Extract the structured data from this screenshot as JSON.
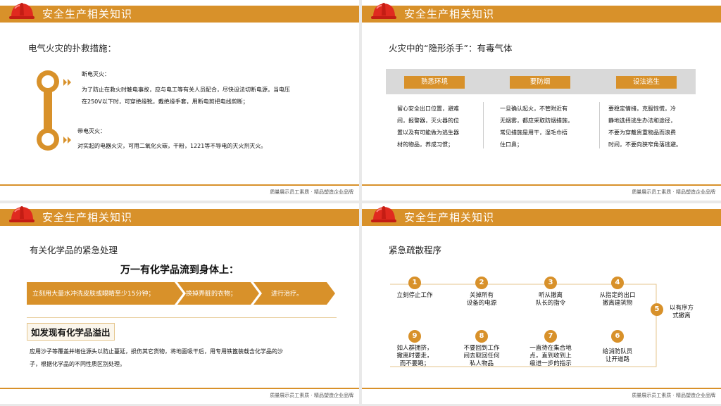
{
  "header_title": "安全生产相关知识",
  "footer": "质量展示员工素质 · 精品塑造企业品牌",
  "slide1": {
    "subtitle": "电气火灾的扑救措施：",
    "item1_title": "断电灭火：",
    "item1_text1": "为了防止在救火时触电事故，应与电工等有关人员配合，尽快设法切断电源，当电压",
    "item1_text2": "在250V以下时，可穿绝缘靴，戴绝缘手套，用断电剪把电线剪断；",
    "item2_title": "带电灭火：",
    "item2_text": "对实起的电器火灾，可用二氧化火碳，干粉，1221等不导电的灭火剂灭火。"
  },
  "slide2": {
    "subtitle": "火灾中的“隐形杀手”：有毒气体",
    "tabs": [
      "熟悉环境",
      "要防烟",
      "设法逃生"
    ],
    "col1": [
      "留心安全出口位置，避难",
      "间，报警器，灭火器的位",
      "置以及有可能做为逃生器",
      "材的物品，养成习惯；"
    ],
    "col2": [
      "一旦确认起火，不管附近有",
      "无烟雾，都应采取防烟措施，",
      "常见措施是用干，湿毛巾捂",
      "住口鼻；"
    ],
    "col3": [
      "要稳定情绪，克服惊慌，冷",
      "静地选择逃生办法和途径，",
      "不要为穿戴贵重物品而浪费",
      "时间，不要向狭窄角落逃避。"
    ]
  },
  "slide3": {
    "subtitle": "有关化学品的紧急处理",
    "heading": "万一有化学品流到身体上：",
    "arrows": [
      "立刻用大量水冲洗皮肤或眼睛至少15分钟；",
      "换掉弄脏的衣物；",
      "进行治疗。"
    ],
    "box_title": "如发现有化学品溢出",
    "text1": "应用沙子等覆盖并堵住源头以防止蔓延，损伤其它货物，将地面吸干后，用专用铁篦装载含化学品的沙",
    "text2": "子，根据化学品的不同性质区别处理。"
  },
  "slide4": {
    "subtitle": "紧急疏散程序",
    "steps": [
      {
        "num": "1",
        "l1": "立刻停止工作",
        "l2": "",
        "l3": ""
      },
      {
        "num": "2",
        "l1": "关掉所有",
        "l2": "设备的电源",
        "l3": ""
      },
      {
        "num": "3",
        "l1": "听从撤离",
        "l2": "队长的指令",
        "l3": ""
      },
      {
        "num": "4",
        "l1": "从指定的出口",
        "l2": "撤离建筑物",
        "l3": ""
      },
      {
        "num": "5",
        "l1": "以有序方",
        "l2": "式撤离",
        "l3": ""
      },
      {
        "num": "6",
        "l1": "给消防队员",
        "l2": "让开道路",
        "l3": ""
      },
      {
        "num": "7",
        "l1": "一直待在集合地",
        "l2": "点，直到收到上",
        "l3": "级进一步的指示"
      },
      {
        "num": "8",
        "l1": "不要回到工作",
        "l2": "间去取回任何",
        "l3": "私人物品"
      },
      {
        "num": "9",
        "l1": "如人群拥挤，",
        "l2": "撤离时要走，",
        "l3": "而不要跑；"
      }
    ]
  },
  "colors": {
    "accent": "#d8912a",
    "helmet": "#e02a1f"
  }
}
